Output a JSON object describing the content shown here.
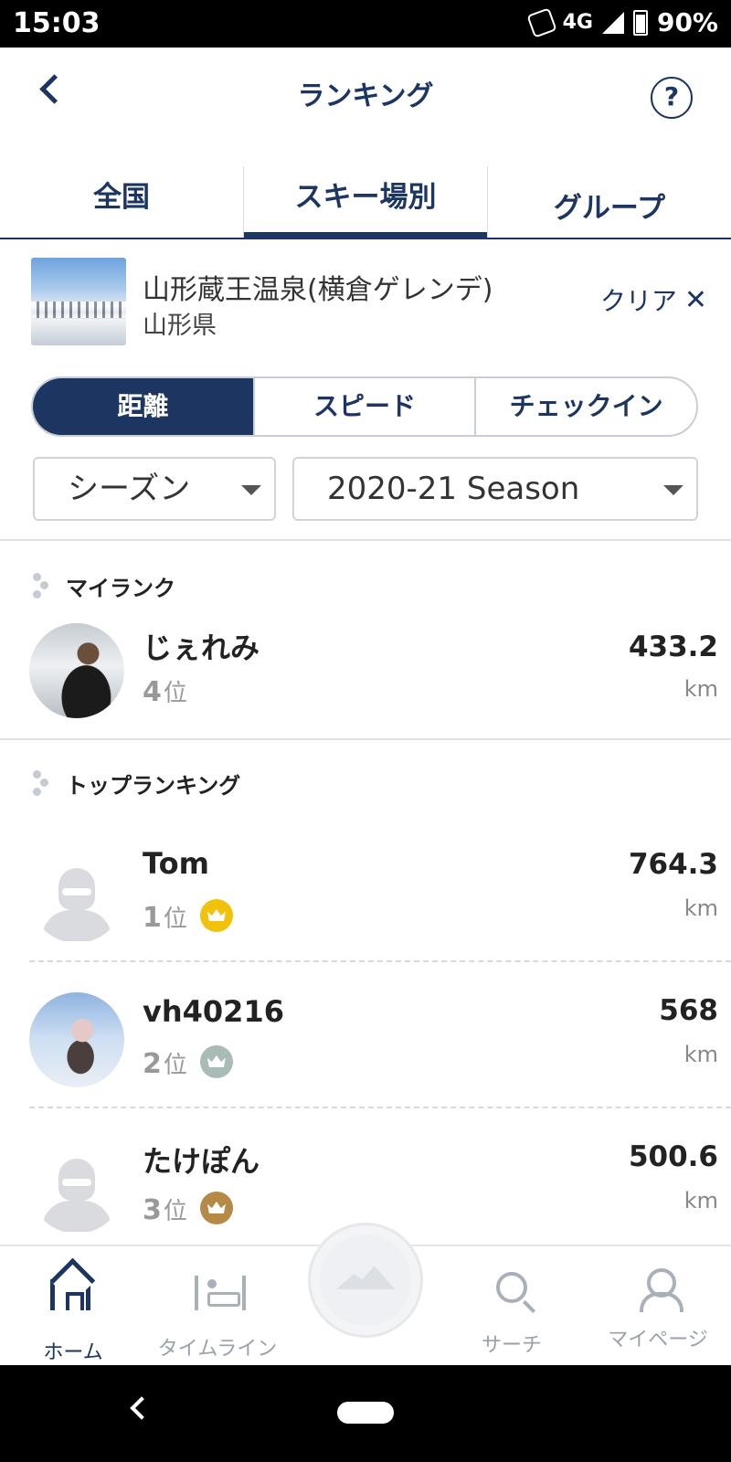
{
  "status_bar": {
    "time": "15:03",
    "network": "4G",
    "battery": "90%"
  },
  "header": {
    "title": "ランキング",
    "help": "?"
  },
  "tabs": [
    {
      "label": "全国"
    },
    {
      "label": "スキー場別"
    },
    {
      "label": "グループ"
    }
  ],
  "resort": {
    "name": "山形蔵王温泉(横倉ゲレンデ)",
    "prefecture": "山形県",
    "clear_label": "クリア",
    "clear_icon": "✕"
  },
  "segments": [
    {
      "label": "距離"
    },
    {
      "label": "スピード"
    },
    {
      "label": "チェックイン"
    }
  ],
  "filters": {
    "period": "シーズン",
    "season": "2020-21 Season"
  },
  "my_rank": {
    "section_title": "マイランク",
    "name": "じぇれみ",
    "rank": "4",
    "rank_suffix": "位",
    "value": "433.2",
    "unit": "km"
  },
  "top_ranking": {
    "section_title": "トップランキング",
    "entries": [
      {
        "name": "Tom",
        "rank": "1",
        "rank_suffix": "位",
        "value": "764.3",
        "unit": "km",
        "crown": "gold"
      },
      {
        "name": "vh40216",
        "rank": "2",
        "rank_suffix": "位",
        "value": "568",
        "unit": "km",
        "crown": "silver"
      },
      {
        "name": "たけぽん",
        "rank": "3",
        "rank_suffix": "位",
        "value": "500.6",
        "unit": "km",
        "crown": "bronze"
      }
    ]
  },
  "bottom_nav": [
    {
      "label": "ホーム",
      "icon": "home-icon"
    },
    {
      "label": "タイムライン",
      "icon": "timeline-icon"
    },
    {
      "label": "",
      "icon": "mountain-icon"
    },
    {
      "label": "サーチ",
      "icon": "search-icon"
    },
    {
      "label": "マイページ",
      "icon": "user-icon"
    }
  ],
  "colors": {
    "accent": "#1c3561",
    "gold": "#f0c20b",
    "silver": "#a9bbb6",
    "bronze": "#b58a47"
  }
}
